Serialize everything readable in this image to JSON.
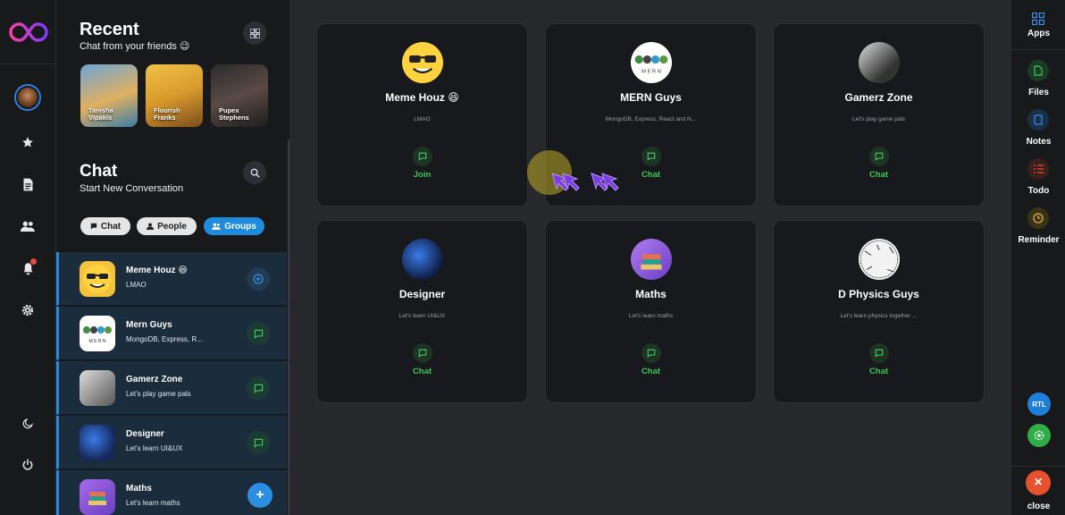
{
  "sidebar": {
    "recent_title": "Recent",
    "recent_subtitle": "Chat from your friends 😉",
    "stories": [
      {
        "line1": "Tanisha",
        "line2": "Vipakis"
      },
      {
        "line1": "Flourish",
        "line2": "Franks"
      },
      {
        "line1": "Pupex",
        "line2": "Stephens"
      }
    ],
    "chat_title": "Chat",
    "chat_subtitle": "Start New Conversation",
    "filters": [
      "Chat",
      "People",
      "Groups"
    ],
    "conversations": [
      {
        "name": "Meme Houz 😆",
        "sub": "LMAO"
      },
      {
        "name": "Mern Guys",
        "sub": "MongoDB, Express, R..."
      },
      {
        "name": "Gamerz Zone",
        "sub": "Let's play game pals"
      },
      {
        "name": "Designer",
        "sub": "Let's learn UI&UX"
      },
      {
        "name": "Maths",
        "sub": "Let's learn maths"
      }
    ],
    "fab": "+"
  },
  "cards": [
    {
      "name": "Meme Houz 😆",
      "sub": "LMAO",
      "action": "Join"
    },
    {
      "name": "MERN Guys",
      "sub": "MongoDB, Express, React and N...",
      "action": "Chat"
    },
    {
      "name": "Gamerz Zone",
      "sub": "Let's play game pals",
      "action": "Chat"
    },
    {
      "name": "Designer",
      "sub": "Let's learn UI&UX",
      "action": "Chat"
    },
    {
      "name": "Maths",
      "sub": "Let's learn maths",
      "action": "Chat"
    },
    {
      "name": "D Physics Guys",
      "sub": "Let's learn physics together ...",
      "action": "Chat"
    }
  ],
  "right_rail": {
    "apps": "Apps",
    "files": "Files",
    "notes": "Notes",
    "todo": "Todo",
    "reminder": "Reminder",
    "rtl": "RTL",
    "close": "close",
    "close_glyph": "×"
  },
  "colors": {
    "accent_blue": "#2a88d6",
    "green": "#3fc659",
    "danger": "#e8512f"
  }
}
